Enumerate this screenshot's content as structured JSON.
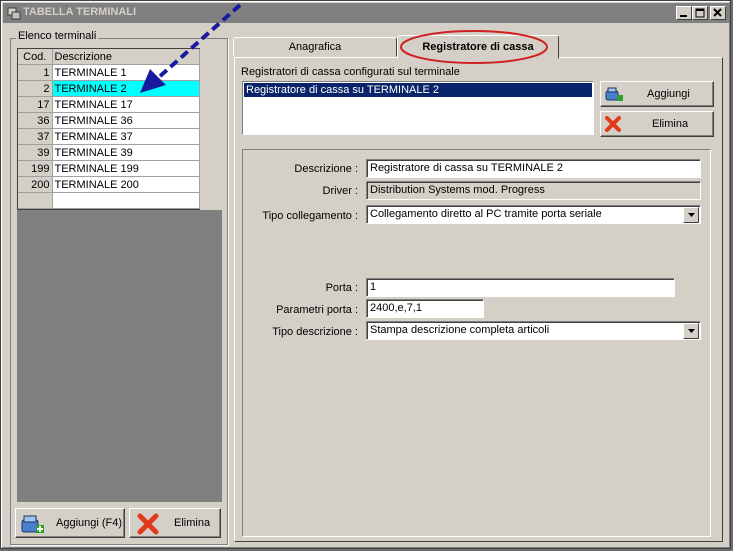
{
  "window": {
    "title": "TABELLA TERMINALI"
  },
  "left": {
    "group_label": "Elenco terminali",
    "columns": [
      "Cod.",
      "Descrizione"
    ],
    "rows": [
      {
        "code": "1",
        "desc": "TERMINALE 1"
      },
      {
        "code": "2",
        "desc": "TERMINALE 2"
      },
      {
        "code": "17",
        "desc": "TERMINALE 17"
      },
      {
        "code": "36",
        "desc": "TERMINALE 36"
      },
      {
        "code": "37",
        "desc": "TERMINALE 37"
      },
      {
        "code": "39",
        "desc": "TERMINALE 39"
      },
      {
        "code": "199",
        "desc": "TERMINALE 199"
      },
      {
        "code": "200",
        "desc": "TERMINALE 200"
      },
      {
        "code": "",
        "desc": ""
      }
    ],
    "selected_index": 1,
    "add_button": "Aggiungi (F4)",
    "delete_button": "Elimina"
  },
  "tabs": [
    {
      "label": "Anagrafica"
    },
    {
      "label": "Registratore di cassa"
    }
  ],
  "active_tab": 1,
  "register": {
    "list_label": "Registratori di cassa configurati sul terminale",
    "items": [
      "Registratore di cassa su TERMINALE 2"
    ],
    "add_button": "Aggiungi",
    "delete_button": "Elimina"
  },
  "form": {
    "descrizione_label": "Descrizione :",
    "descrizione_value": "Registratore di cassa su TERMINALE 2",
    "driver_label": "Driver :",
    "driver_value": "Distribution Systems mod. Progress",
    "tipo_collegamento_label": "Tipo collegamento :",
    "tipo_collegamento_value": "Collegamento diretto al PC tramite porta seriale",
    "porta_label": "Porta :",
    "porta_value": "1",
    "parametri_label": "Parametri porta :",
    "parametri_value": "2400,e,7,1",
    "tipo_descrizione_label": "Tipo descrizione :",
    "tipo_descrizione_value": "Stampa descrizione completa articoli"
  },
  "colors": {
    "selection_row": "#00ffff",
    "list_selection": "#0a246a",
    "annotation_arrow": "#1a1aa0",
    "annotation_circle": "#d02020"
  }
}
